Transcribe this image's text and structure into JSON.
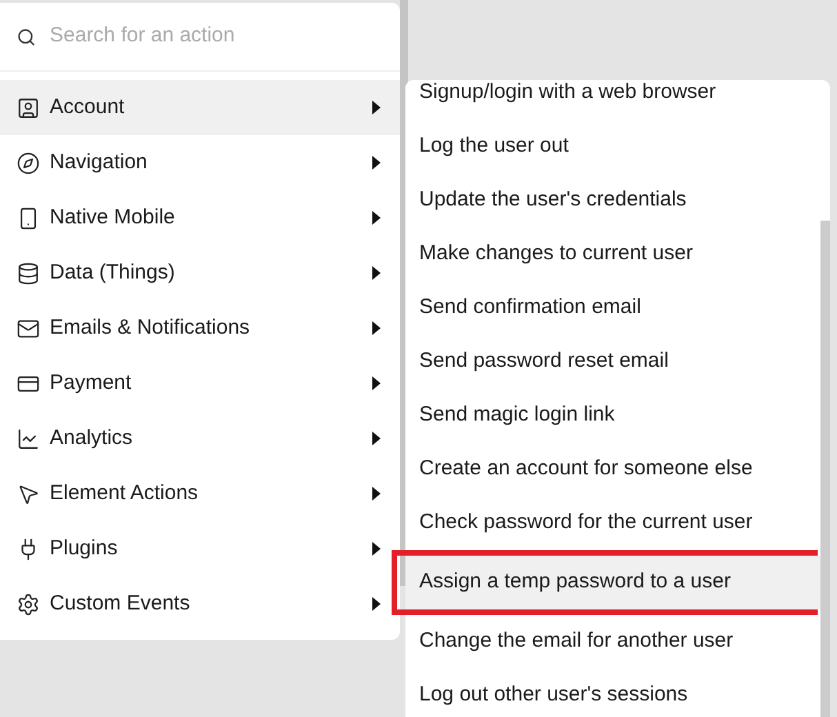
{
  "search": {
    "placeholder": "Search for an action"
  },
  "categories": [
    {
      "label": "Account",
      "selected": true
    },
    {
      "label": "Navigation",
      "selected": false
    },
    {
      "label": "Native Mobile",
      "selected": false
    },
    {
      "label": "Data (Things)",
      "selected": false
    },
    {
      "label": "Emails & Notifications",
      "selected": false
    },
    {
      "label": "Payment",
      "selected": false
    },
    {
      "label": "Analytics",
      "selected": false
    },
    {
      "label": "Element Actions",
      "selected": false
    },
    {
      "label": "Plugins",
      "selected": false
    },
    {
      "label": "Custom Events",
      "selected": false
    }
  ],
  "submenu": [
    {
      "label": "Signup/login with a web browser",
      "selected": false,
      "outlined": false
    },
    {
      "label": "Log the user out",
      "selected": false,
      "outlined": false
    },
    {
      "label": "Update the user's credentials",
      "selected": false,
      "outlined": false
    },
    {
      "label": "Make changes to current user",
      "selected": false,
      "outlined": false
    },
    {
      "label": "Send confirmation email",
      "selected": false,
      "outlined": false
    },
    {
      "label": "Send password reset email",
      "selected": false,
      "outlined": false
    },
    {
      "label": "Send magic login link",
      "selected": false,
      "outlined": false
    },
    {
      "label": "Create an account for someone else",
      "selected": false,
      "outlined": false
    },
    {
      "label": "Check password for the current user",
      "selected": false,
      "outlined": false
    },
    {
      "label": "Assign a temp password to a user",
      "selected": true,
      "outlined": true
    },
    {
      "label": "Change the email for another user",
      "selected": false,
      "outlined": false
    },
    {
      "label": "Log out other user's sessions",
      "selected": false,
      "outlined": false
    }
  ]
}
